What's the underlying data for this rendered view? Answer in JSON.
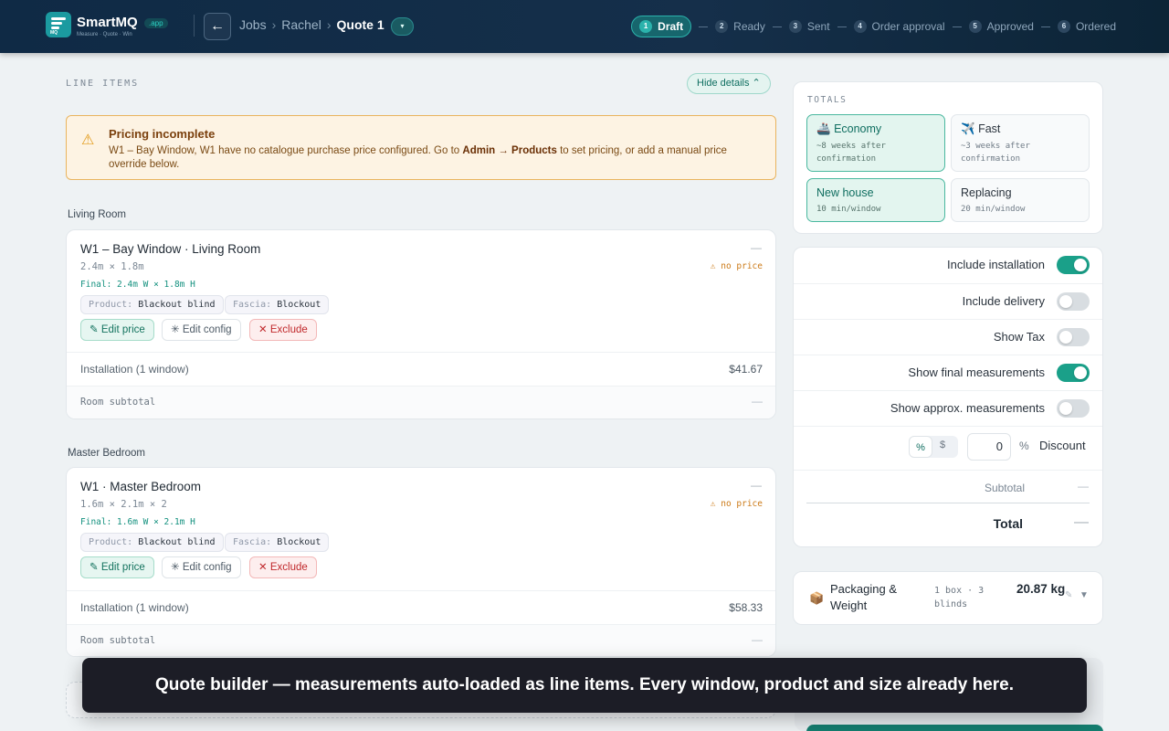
{
  "header": {
    "brand": "SmartMQ",
    "brand_badge": ".app",
    "brand_tagline": "Measure · Quote · Win",
    "logo_text": "MQ",
    "back_icon": "←",
    "breadcrumbs": [
      "Jobs",
      "Rachel",
      "Quote 1"
    ],
    "breadcrumb_sep": "›",
    "dropdown_icon": "▾",
    "steps": [
      {
        "num": "1",
        "label": "Draft",
        "active": true
      },
      {
        "num": "2",
        "label": "Ready",
        "active": false
      },
      {
        "num": "3",
        "label": "Sent",
        "active": false
      },
      {
        "num": "4",
        "label": "Order approval",
        "active": false
      },
      {
        "num": "5",
        "label": "Approved",
        "active": false
      },
      {
        "num": "6",
        "label": "Ordered",
        "active": false
      }
    ]
  },
  "line_items": {
    "section_label": "LINE ITEMS",
    "hide_details": "Hide details",
    "hide_details_icon": "⌃"
  },
  "warning": {
    "icon": "⚠",
    "title": "Pricing incomplete",
    "text_before": "W1 – Bay Window, W1 have no catalogue purchase price configured. Go to ",
    "link": "Admin → Products",
    "text_after": " to set pricing, or add a manual price override below."
  },
  "rooms": [
    {
      "name": "Living Room",
      "item": {
        "title": "W1 – Bay Window · Living Room",
        "dash": "—",
        "no_price": "⚠ no price",
        "size": "2.4m × 1.8m",
        "final": "Final: 2.4m W × 1.8m H",
        "product_key": "Product:",
        "product_val": "Blackout blind",
        "fascia_key": "Fascia:",
        "fascia_val": "Blockout"
      },
      "install_label": "Installation (1 window)",
      "install_price": "$41.67",
      "subtotal_label": "Room subtotal",
      "subtotal_value": "—"
    },
    {
      "name": "Master Bedroom",
      "item": {
        "title": "W1 · Master Bedroom",
        "dash": "—",
        "no_price": "⚠ no price",
        "size": "1.6m × 2.1m × 2",
        "final": "Final: 1.6m W × 2.1m H",
        "product_key": "Product:",
        "product_val": "Blackout blind",
        "fascia_key": "Fascia:",
        "fascia_val": "Blockout"
      },
      "install_label": "Installation (1 window)",
      "install_price": "$58.33",
      "subtotal_label": "Room subtotal",
      "subtotal_value": "—"
    }
  ],
  "actions": {
    "edit_price": "Edit price",
    "edit_price_icon": "✎",
    "edit_config": "Edit config",
    "edit_config_icon": "✳",
    "exclude": "Exclude",
    "exclude_icon": "✕"
  },
  "totals": {
    "label": "TOTALS",
    "shipping": [
      {
        "icon": "🚢",
        "title": "Economy",
        "sub": "~8 weeks after confirmation",
        "selected": true
      },
      {
        "icon": "✈️",
        "title": "Fast",
        "sub": "~3 weeks after confirmation",
        "selected": false
      }
    ],
    "install_type": [
      {
        "title": "New house",
        "sub": "10 min/window",
        "selected": true
      },
      {
        "title": "Replacing",
        "sub": "20 min/window",
        "selected": false
      }
    ]
  },
  "options": {
    "toggles": [
      {
        "label": "Include installation",
        "on": true
      },
      {
        "label": "Include delivery",
        "on": false
      },
      {
        "label": "Show Tax",
        "on": false
      },
      {
        "label": "Show final measurements",
        "on": true
      },
      {
        "label": "Show approx. measurements",
        "on": false
      }
    ],
    "discount_pct_btn": "%",
    "discount_dollar_btn": "$",
    "discount_value": "0",
    "discount_unit": "%",
    "discount_label": "Discount",
    "subtotal_label": "Subtotal",
    "subtotal_value": "—",
    "total_label": "Total",
    "total_value": "—"
  },
  "packaging": {
    "icon": "📦",
    "title": "Packaging & Weight",
    "meta": "1 box · 3 blinds",
    "weight": "20.87 kg",
    "edit_icon": "✎",
    "chevron_icon": "▼"
  },
  "toast": {
    "text": "Quote builder — measurements auto-loaded as line items. Every window, product and size already here."
  },
  "colors": {
    "accent": "#1aa089",
    "header_bg": "#0f2a45",
    "warning_bg": "#fdf3e3",
    "danger": "#c0282b"
  }
}
